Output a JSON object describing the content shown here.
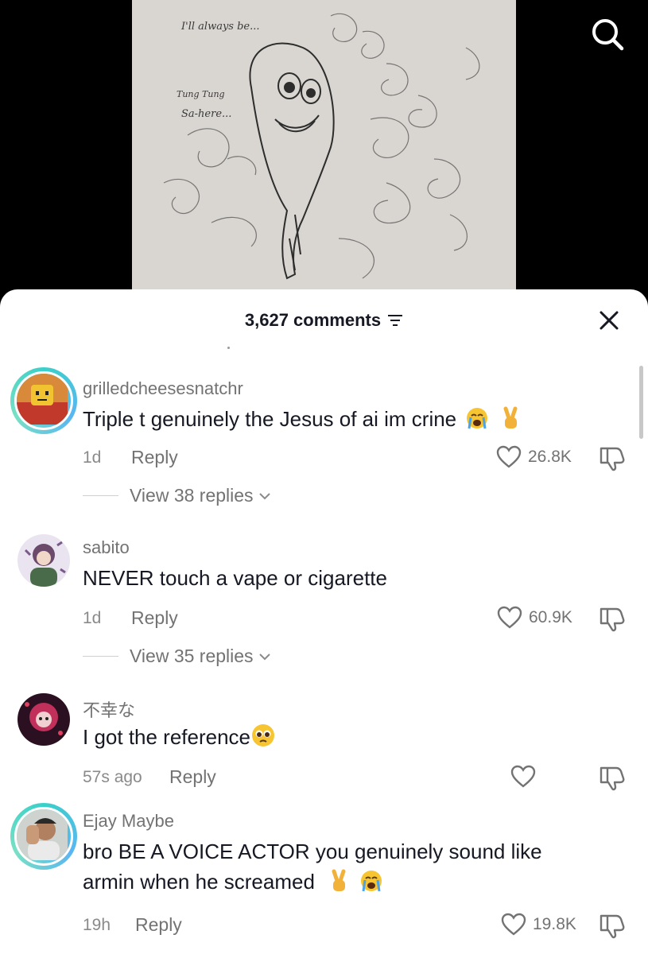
{
  "video": {
    "sketch_text_1": "I'll always be...",
    "sketch_text_2": "Tung Tung",
    "sketch_text_3": "Sa-here..."
  },
  "header": {
    "comment_count": "3,627 comments"
  },
  "comments": [
    {
      "username": "grilledcheesesnatchr",
      "text": "Triple t genuinely the Jesus of ai im crine",
      "time": "1d",
      "reply_label": "Reply",
      "likes": "26.8K",
      "view_replies": "View 38 replies"
    },
    {
      "username": "sabito",
      "text": "NEVER touch a vape or cigarette",
      "time": "1d",
      "reply_label": "Reply",
      "likes": "60.9K",
      "view_replies": "View 35 replies"
    },
    {
      "username": "不幸な",
      "text": "I got the reference",
      "time": "57s ago",
      "reply_label": "Reply",
      "likes": ""
    },
    {
      "username": "Ejay Maybe",
      "text_line1": "bro BE A VOICE ACTOR you genuinely sound like",
      "text_line2": "armin when he screamed",
      "time": "19h",
      "reply_label": "Reply",
      "likes": "19.8K"
    }
  ],
  "colors": {
    "text_primary": "#161823",
    "text_secondary": "#737373",
    "avatar_ring": "#3ad0c9"
  }
}
